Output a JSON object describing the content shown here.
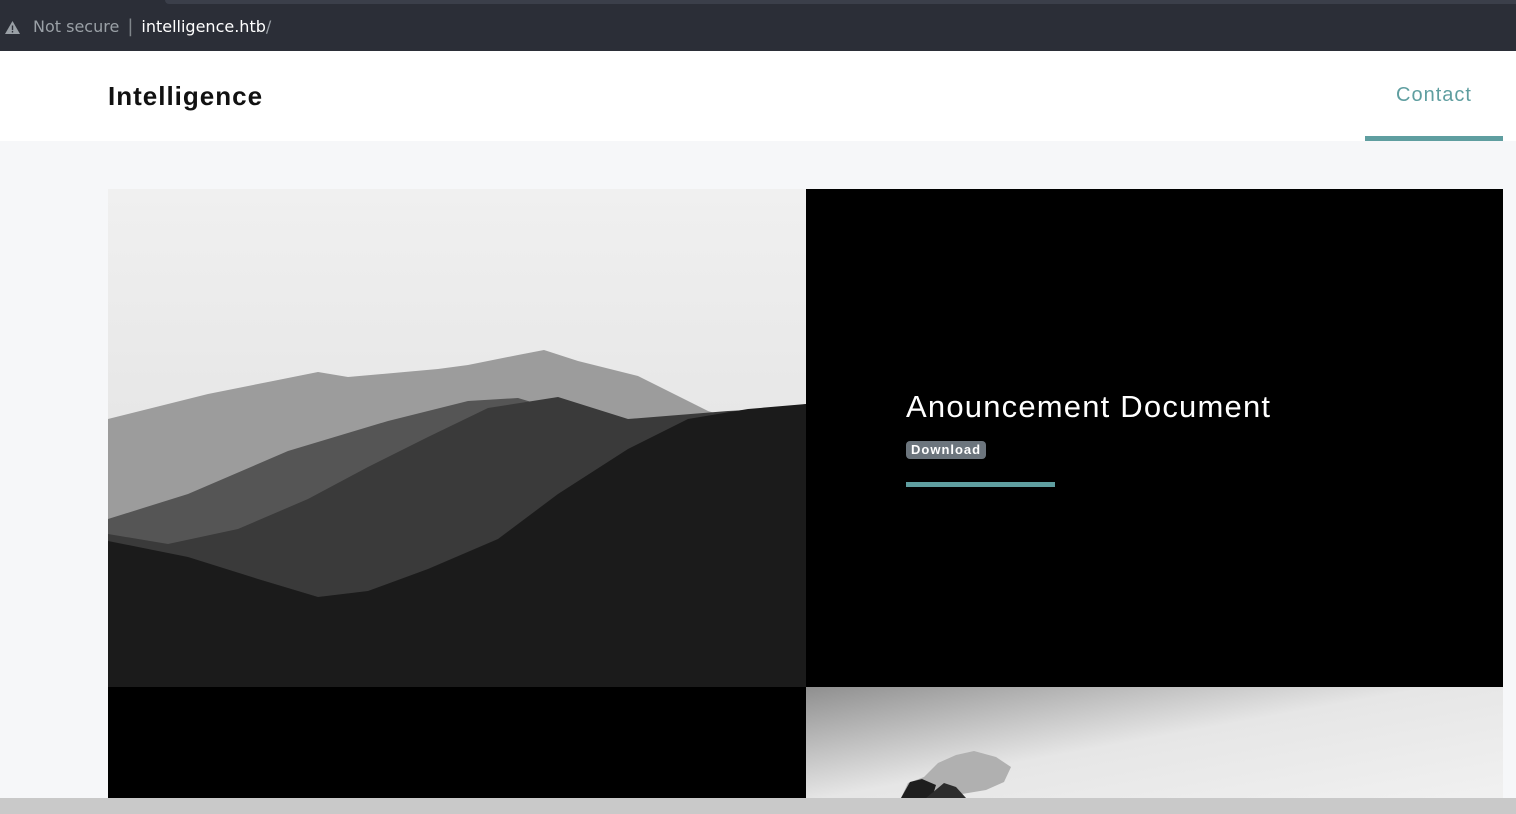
{
  "browser": {
    "security_label": "Not secure",
    "url_host": "intelligence.htb",
    "url_path": "/"
  },
  "header": {
    "brand": "Intelligence",
    "nav": {
      "contact_label": "Contact"
    }
  },
  "posts": [
    {
      "title": "Anouncement Document",
      "action_label": "Download"
    }
  ],
  "colors": {
    "accent": "#5f9ea0",
    "badge": "#6c757d",
    "browser_bar": "#2b2e37"
  },
  "icons": {
    "security": "warning-triangle-icon"
  }
}
